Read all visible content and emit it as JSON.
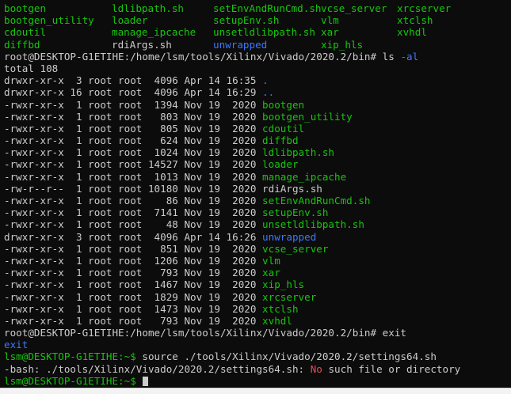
{
  "colors": {
    "background": "#0c0c0c",
    "text": "#cccccc",
    "executable": "#16c60c",
    "directory": "#3b78ff",
    "error_word": "#e74856"
  },
  "listing_grid": [
    [
      {
        "text": "bootgen",
        "kind": "exe"
      },
      {
        "text": "ldlibpath.sh",
        "kind": "exe"
      },
      {
        "text": "setEnvAndRunCmd.sh",
        "kind": "exe"
      },
      {
        "text": "vcse_server",
        "kind": "exe"
      },
      {
        "text": "xrcserver",
        "kind": "exe"
      }
    ],
    [
      {
        "text": "bootgen_utility",
        "kind": "exe"
      },
      {
        "text": "loader",
        "kind": "exe"
      },
      {
        "text": "setupEnv.sh",
        "kind": "exe"
      },
      {
        "text": "vlm",
        "kind": "exe"
      },
      {
        "text": "xtclsh",
        "kind": "exe"
      }
    ],
    [
      {
        "text": "cdoutil",
        "kind": "exe"
      },
      {
        "text": "manage_ipcache",
        "kind": "exe"
      },
      {
        "text": "unsetldlibpath.sh",
        "kind": "exe"
      },
      {
        "text": "xar",
        "kind": "exe"
      },
      {
        "text": "xvhdl",
        "kind": "exe"
      }
    ],
    [
      {
        "text": "diffbd",
        "kind": "exe"
      },
      {
        "text": "rdiArgs.sh",
        "kind": "plain"
      },
      {
        "text": "unwrapped",
        "kind": "dir"
      },
      {
        "text": "xip_hls",
        "kind": "exe"
      },
      {
        "text": "",
        "kind": "plain"
      }
    ]
  ],
  "prompt_root": "root@DESKTOP-G1ETIHE:/home/lsm/tools/Xilinx/Vivado/2020.2/bin#",
  "ls_command": {
    "cmd": " ls ",
    "flag": "-al"
  },
  "total_line": "total 108",
  "long_listing": [
    {
      "meta": "drwxr-xr-x  3 root root  4096 Apr 14 16:35 ",
      "name": ".",
      "kind": "dir"
    },
    {
      "meta": "drwxr-xr-x 16 root root  4096 Apr 14 16:29 ",
      "name": "..",
      "kind": "dir"
    },
    {
      "meta": "-rwxr-xr-x  1 root root  1394 Nov 19  2020 ",
      "name": "bootgen",
      "kind": "exe"
    },
    {
      "meta": "-rwxr-xr-x  1 root root   803 Nov 19  2020 ",
      "name": "bootgen_utility",
      "kind": "exe"
    },
    {
      "meta": "-rwxr-xr-x  1 root root   805 Nov 19  2020 ",
      "name": "cdoutil",
      "kind": "exe"
    },
    {
      "meta": "-rwxr-xr-x  1 root root   624 Nov 19  2020 ",
      "name": "diffbd",
      "kind": "exe"
    },
    {
      "meta": "-rwxr-xr-x  1 root root  1024 Nov 19  2020 ",
      "name": "ldlibpath.sh",
      "kind": "exe"
    },
    {
      "meta": "-rwxr-xr-x  1 root root 14527 Nov 19  2020 ",
      "name": "loader",
      "kind": "exe"
    },
    {
      "meta": "-rwxr-xr-x  1 root root  1013 Nov 19  2020 ",
      "name": "manage_ipcache",
      "kind": "exe"
    },
    {
      "meta": "-rw-r--r--  1 root root 10180 Nov 19  2020 ",
      "name": "rdiArgs.sh",
      "kind": "plain"
    },
    {
      "meta": "-rwxr-xr-x  1 root root    86 Nov 19  2020 ",
      "name": "setEnvAndRunCmd.sh",
      "kind": "exe"
    },
    {
      "meta": "-rwxr-xr-x  1 root root  7141 Nov 19  2020 ",
      "name": "setupEnv.sh",
      "kind": "exe"
    },
    {
      "meta": "-rwxr-xr-x  1 root root    48 Nov 19  2020 ",
      "name": "unsetldlibpath.sh",
      "kind": "exe"
    },
    {
      "meta": "drwxr-xr-x  3 root root  4096 Apr 14 16:26 ",
      "name": "unwrapped",
      "kind": "dir"
    },
    {
      "meta": "-rwxr-xr-x  1 root root   851 Nov 19  2020 ",
      "name": "vcse_server",
      "kind": "exe"
    },
    {
      "meta": "-rwxr-xr-x  1 root root  1206 Nov 19  2020 ",
      "name": "vlm",
      "kind": "exe"
    },
    {
      "meta": "-rwxr-xr-x  1 root root   793 Nov 19  2020 ",
      "name": "xar",
      "kind": "exe"
    },
    {
      "meta": "-rwxr-xr-x  1 root root  1467 Nov 19  2020 ",
      "name": "xip_hls",
      "kind": "exe"
    },
    {
      "meta": "-rwxr-xr-x  1 root root  1829 Nov 19  2020 ",
      "name": "xrcserver",
      "kind": "exe"
    },
    {
      "meta": "-rwxr-xr-x  1 root root  1473 Nov 19  2020 ",
      "name": "xtclsh",
      "kind": "exe"
    },
    {
      "meta": "-rwxr-xr-x  1 root root   793 Nov 19  2020 ",
      "name": "xvhdl",
      "kind": "exe"
    }
  ],
  "exit_command": " exit",
  "exit_echo": "exit",
  "user_prompt": "lsm@DESKTOP-G1ETIHE:~$",
  "source_command": " source ./tools/Xilinx/Vivado/2020.2/settings64.sh",
  "error_line": {
    "prefix": "-bash: ./tools/Xilinx/Vivado/2020.2/settings64.sh: ",
    "no": "No",
    "suffix": " such file or directory"
  },
  "final_prompt": "lsm@DESKTOP-G1ETIHE:~$"
}
